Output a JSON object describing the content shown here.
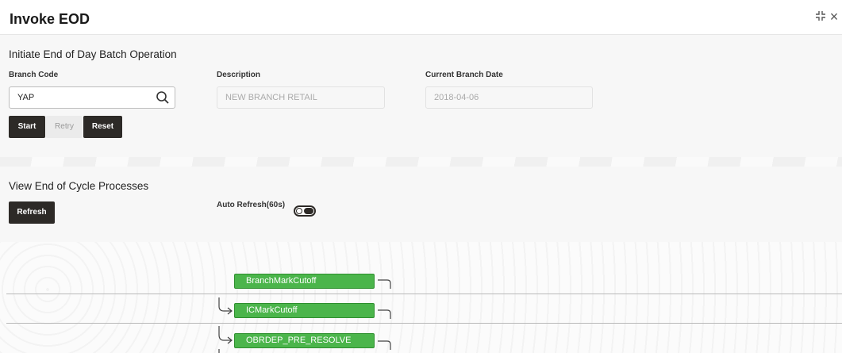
{
  "header": {
    "title": "Invoke EOD",
    "minimize_icon": "collapse-icon",
    "close_icon": "close-icon"
  },
  "initiate": {
    "section_title": "Initiate End of Day Batch Operation",
    "branch_code": {
      "label": "Branch Code",
      "value": "YAP"
    },
    "description": {
      "label": "Description",
      "value": "NEW BRANCH RETAIL"
    },
    "current_branch_date": {
      "label": "Current Branch Date",
      "value": "2018-04-06"
    },
    "buttons": {
      "start": "Start",
      "retry": "Retry",
      "reset": "Reset"
    }
  },
  "processes": {
    "section_title": "View End of Cycle Processes",
    "refresh": "Refresh",
    "auto_refresh_label": "Auto Refresh(60s)",
    "auto_refresh_on": false,
    "nodes": [
      "BranchMarkCutoff",
      "ICMarkCutoff",
      "OBRDEP_PRE_RESOLVE"
    ],
    "node_color": "#4bb54b"
  }
}
